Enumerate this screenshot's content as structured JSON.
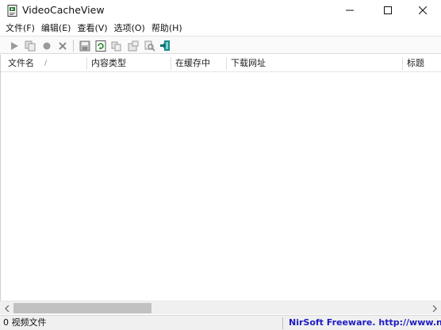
{
  "window": {
    "title": "VideoCacheView"
  },
  "menu": [
    {
      "label": "文件(F)"
    },
    {
      "label": "编辑(E)"
    },
    {
      "label": "查看(V)"
    },
    {
      "label": "选项(O)"
    },
    {
      "label": "帮助(H)"
    }
  ],
  "toolbar": {
    "icons": [
      "play-icon",
      "copy-files-icon",
      "record-icon",
      "delete-icon",
      "save-icon",
      "refresh-icon",
      "copy-icon",
      "properties-icon",
      "find-icon",
      "exit-icon"
    ]
  },
  "list": {
    "columns": [
      {
        "label": "文件名"
      },
      {
        "label": "内容类型"
      },
      {
        "label": "在缓存中"
      },
      {
        "label": "下载网址"
      },
      {
        "label": "标题"
      }
    ],
    "sort_indicator": "∕",
    "rows": []
  },
  "statusbar": {
    "count_text": "0 视频文件",
    "brand_text": "NirSoft Freeware.  http://www.nirsoft.net"
  },
  "colors": {
    "link": "#1c1cc4",
    "scroll_thumb": "#c1c1c1",
    "exit_icon": "#1a8a8a"
  }
}
